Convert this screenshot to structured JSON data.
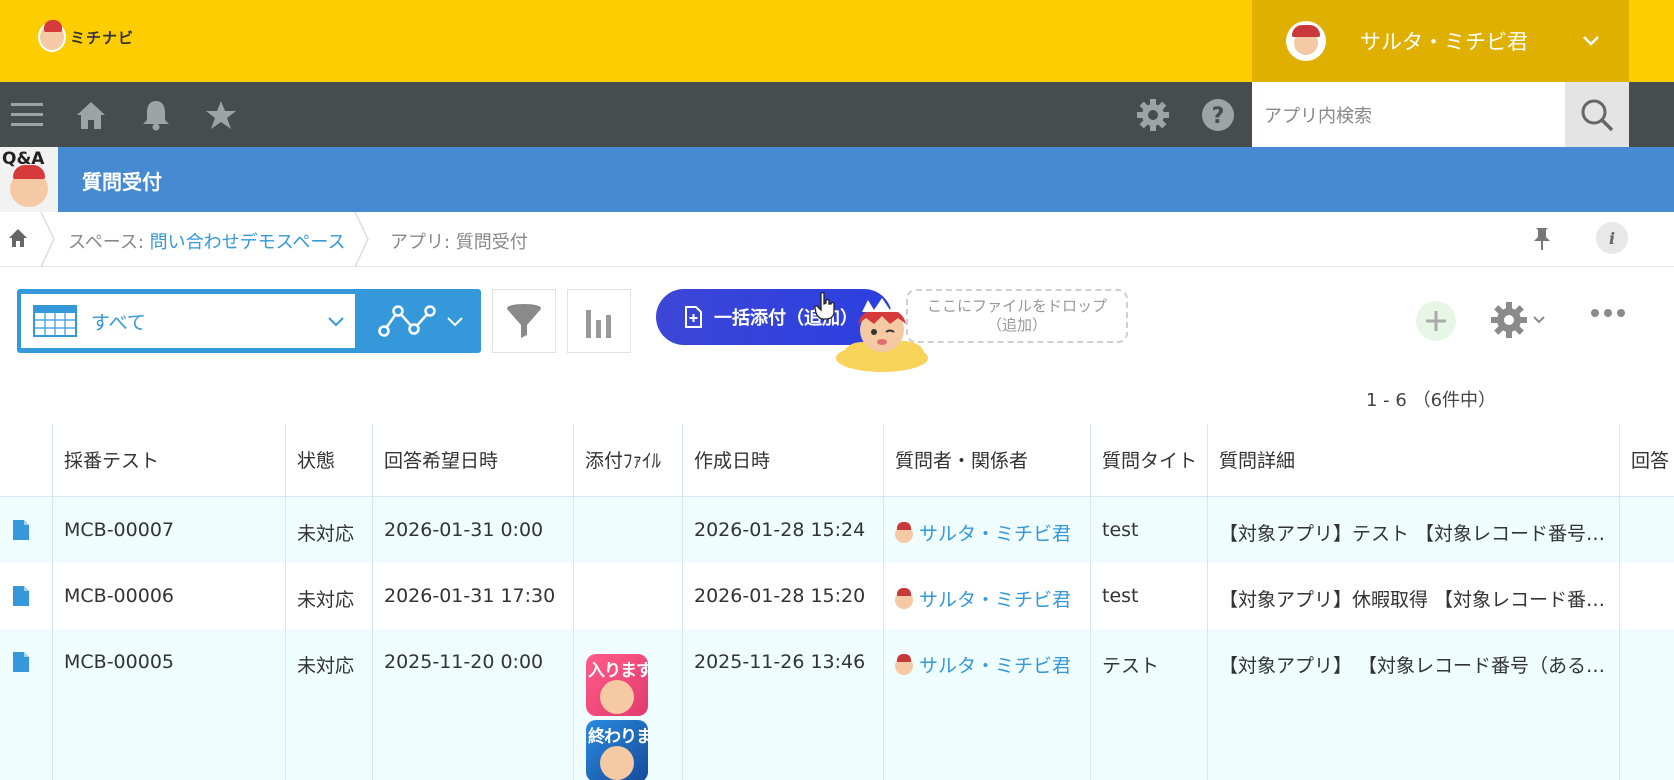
{
  "header": {
    "logo_text": "ミチナビ",
    "user_name": "サルタ・ミチビ君"
  },
  "nav": {
    "search_placeholder": "アプリ内検索"
  },
  "app": {
    "icon_text": "Q&A",
    "title": "質問受付"
  },
  "breadcrumb": {
    "space_prefix": "スペース: ",
    "space_name": "問い合わせデモスペース",
    "app_label": "アプリ: 質問受付"
  },
  "toolbar": {
    "view_label": "すべて",
    "attach_label": "一括添付（追加）",
    "drop_line1": "ここにファイルをドロップ",
    "drop_line2": "（追加）"
  },
  "pager": "1 - 6 （6件中）",
  "table": {
    "columns": [
      "採番テスト",
      "状態",
      "回答希望日時",
      "添付ﾌｧｲﾙ",
      "作成日時",
      "質問者・関係者",
      "質問タイト",
      "質問詳細",
      "回答"
    ],
    "rows": [
      {
        "id": "MCB-00007",
        "status": "未対応",
        "desired": "2026-01-31 0:00",
        "created": "2026-01-28 15:24",
        "user": "サルタ・ミチビ君",
        "title": "test",
        "detail": "【対象アプリ】テスト 【対象レコード番号…"
      },
      {
        "id": "MCB-00006",
        "status": "未対応",
        "desired": "2026-01-31 17:30",
        "created": "2026-01-28 15:20",
        "user": "サルタ・ミチビ君",
        "title": "test",
        "detail": "【対象アプリ】休暇取得 【対象レコード番…"
      },
      {
        "id": "MCB-00005",
        "status": "未対応",
        "desired": "2025-11-20 0:00",
        "created": "2025-11-26 13:46",
        "user": "サルタ・ミチビ君",
        "title": "テスト",
        "detail": "【対象アプリ】 【対象レコード番号（ある…"
      }
    ],
    "thumbs": [
      "入ります",
      "終わりました"
    ]
  },
  "colors": {
    "header_yellow": "#fecd00",
    "nav_dark": "#474d4d",
    "app_blue": "#468ad2",
    "link_blue": "#3498db",
    "attach_button": "#3d46d6",
    "row_tint": "#effdff"
  }
}
